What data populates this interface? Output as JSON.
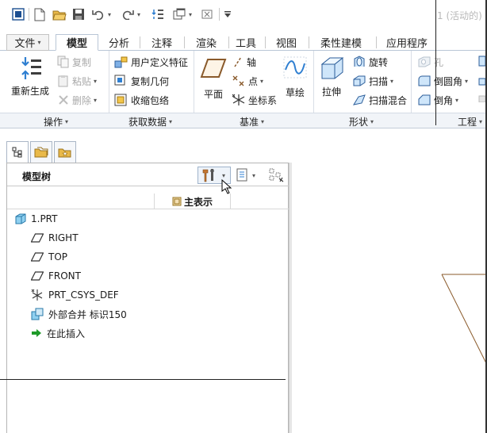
{
  "window": {
    "title": "1 (活动的)"
  },
  "qat": {
    "icons": [
      "window-icon",
      "new-icon",
      "open-icon",
      "save-icon",
      "undo-icon",
      "redo-icon",
      "regenerate-icon",
      "windows-icon",
      "close-window-icon",
      "customize-icon"
    ]
  },
  "tabs": [
    {
      "label": "文件",
      "caret": "▾"
    },
    {
      "label": "模型"
    },
    {
      "label": "分析"
    },
    {
      "label": "注释"
    },
    {
      "label": "渲染"
    },
    {
      "label": "工具"
    },
    {
      "label": "视图"
    },
    {
      "label": "柔性建模"
    },
    {
      "label": "应用程序"
    }
  ],
  "ribbon": {
    "operations": {
      "regenerate": "重新生成",
      "copy": "复制",
      "paste": "粘贴",
      "delete": "删除",
      "group": "操作"
    },
    "get_data": {
      "udf": "用户定义特征",
      "copy_geometry": "复制几何",
      "shrinkwrap": "收缩包络",
      "group": "获取数据"
    },
    "datum": {
      "plane": "平面",
      "axis": "轴",
      "point": "点",
      "csys": "坐标系",
      "sketch": "草绘",
      "group": "基准"
    },
    "shapes": {
      "extrude": "拉伸",
      "revolve": "旋转",
      "sweep": "扫描",
      "swept_blend": "扫描混合",
      "group": "形状"
    },
    "engineering": {
      "hole": "孔",
      "round": "倒圆角",
      "chamfer": "倒角",
      "group": "工程"
    },
    "caret": "▾"
  },
  "model_tree": {
    "title": "模型树",
    "column_main": "主表示",
    "items": [
      {
        "label": "1.PRT",
        "icon": "part-icon"
      },
      {
        "label": "RIGHT",
        "icon": "datum-plane-icon"
      },
      {
        "label": "TOP",
        "icon": "datum-plane-icon"
      },
      {
        "label": "FRONT",
        "icon": "datum-plane-icon"
      },
      {
        "label": "PRT_CSYS_DEF",
        "icon": "csys-icon"
      },
      {
        "label": "外部合并 标识150",
        "icon": "external-merge-icon"
      },
      {
        "label": "在此插入",
        "icon": "insert-here-icon"
      }
    ]
  },
  "colors": {
    "accent_blue": "#2f7fd1",
    "tab_border": "#b9c6d6",
    "insert_green": "#1e9a28",
    "plane_brown": "#8a5a2b",
    "disabled": "#a9a9a9"
  }
}
